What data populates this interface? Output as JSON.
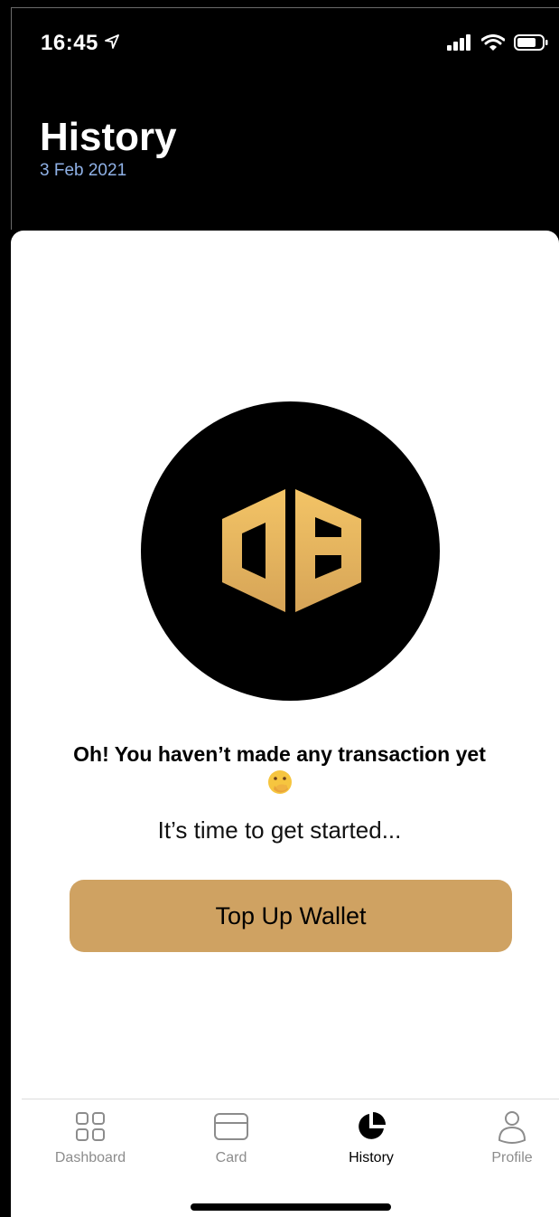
{
  "status": {
    "time": "16:45"
  },
  "header": {
    "title": "History",
    "date": "3 Feb 2021"
  },
  "empty_state": {
    "message": "Oh! You haven’t made any transaction yet",
    "emoji": "face-with-hand-over-mouth",
    "subtitle": "It’s time to get started...",
    "button_label": "Top Up Wallet"
  },
  "colors": {
    "accent": "#cfa262",
    "logo_gold": "#e6b45c",
    "date_blue": "#8fb1e6"
  },
  "tabs": [
    {
      "label": "Dashboard",
      "icon": "grid-icon",
      "active": false
    },
    {
      "label": "Card",
      "icon": "card-icon",
      "active": false
    },
    {
      "label": "History",
      "icon": "pie-chart-icon",
      "active": true
    },
    {
      "label": "Profile",
      "icon": "person-icon",
      "active": false
    }
  ]
}
